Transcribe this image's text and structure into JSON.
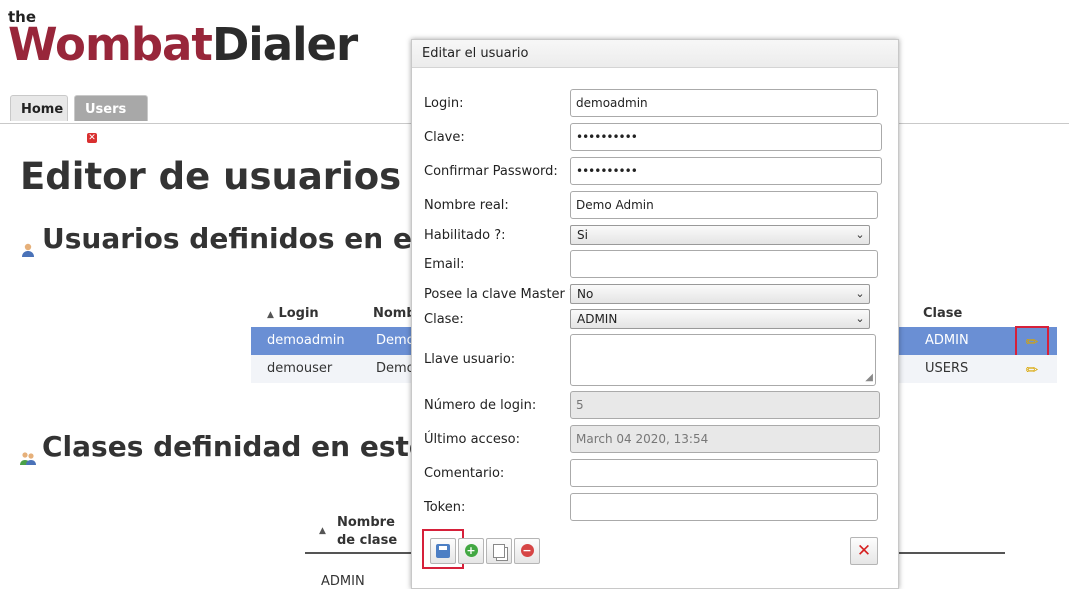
{
  "logo": {
    "the": "the",
    "wombat": "Wombat",
    "dialer": "Dialer"
  },
  "tabs": {
    "home": "Home",
    "users": "Users"
  },
  "page": {
    "title": "Editor de usuarios y cl",
    "section_users": "Usuarios definidos en este",
    "section_classes": "Clases definidad en este s"
  },
  "users_table": {
    "headers": {
      "login": "Login",
      "name": "Nomb",
      "class": "Clase"
    },
    "rows": [
      {
        "login": "demoadmin",
        "name": "Demo",
        "class": "ADMIN"
      },
      {
        "login": "demouser",
        "name": "Demo",
        "class": "USERS"
      }
    ]
  },
  "classes_table": {
    "header": "Nombre de clase",
    "first_row": "ADMIN"
  },
  "dialog": {
    "title": "Editar el usuario",
    "fields": {
      "login": {
        "label": "Login:",
        "value": "demoadmin"
      },
      "password": {
        "label": "Clave:",
        "value": "••••••••••"
      },
      "confirm": {
        "label": "Confirmar Password:",
        "value": "••••••••••"
      },
      "real_name": {
        "label": "Nombre real:",
        "value": "Demo Admin"
      },
      "enabled": {
        "label": "Habilitado ?:",
        "value": "Si"
      },
      "email": {
        "label": "Email:",
        "value": ""
      },
      "master_key": {
        "label": "Posee la clave Master ?:",
        "value": "No"
      },
      "class": {
        "label": "Clase:",
        "value": "ADMIN"
      },
      "user_key": {
        "label": "Llave usuario:",
        "value": ""
      },
      "login_count": {
        "label": "Número de login:",
        "value": "5"
      },
      "last_access": {
        "label": "Último acceso:",
        "value": "March 04 2020, 13:54"
      },
      "comment": {
        "label": "Comentario:",
        "value": ""
      },
      "token": {
        "label": "Token:",
        "value": ""
      }
    }
  },
  "icons": {
    "edit": "pencil-icon",
    "save": "floppy-disk-icon",
    "add": "plus-circle-icon",
    "copy": "copy-icon",
    "remove": "minus-circle-icon",
    "close": "x-icon",
    "sort": "triangle-up-icon"
  },
  "colors": {
    "brand": "#98263a",
    "selected_row": "#6a8fd4",
    "highlight": "#d6203a"
  }
}
